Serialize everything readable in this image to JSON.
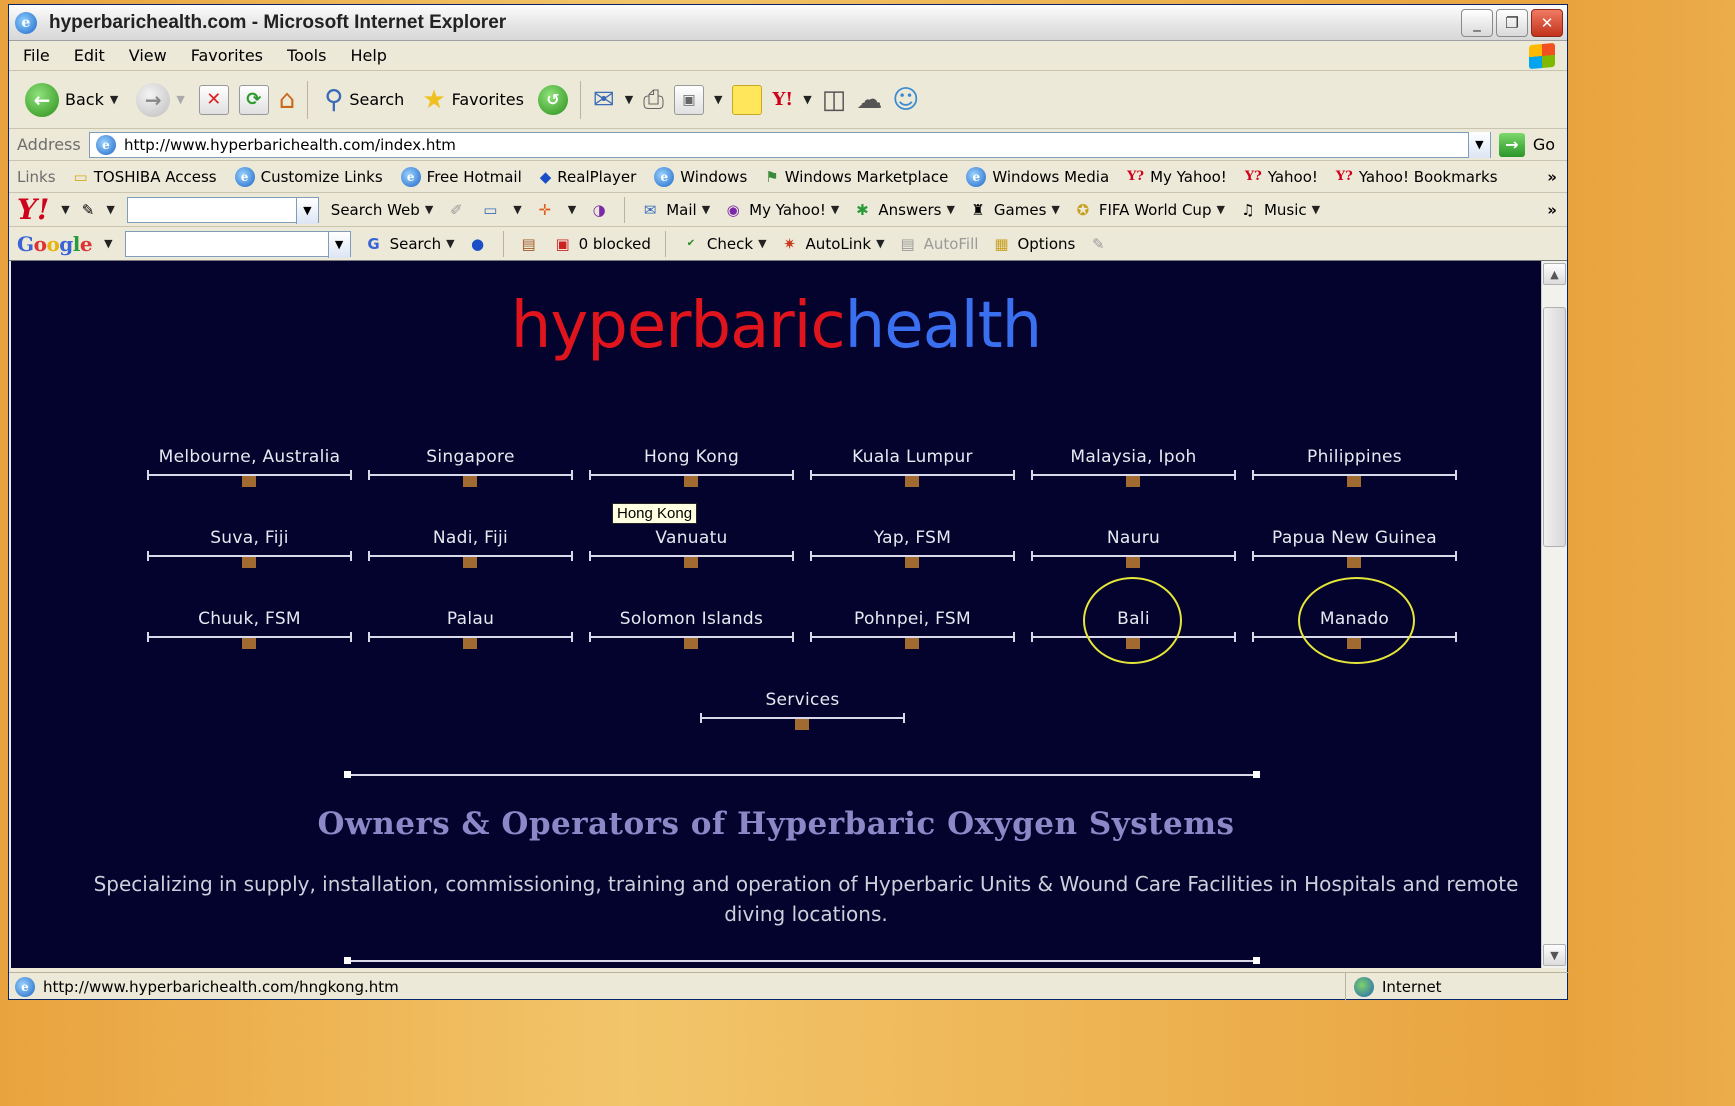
{
  "window": {
    "title": "hyperbarichealth.com - Microsoft Internet Explorer",
    "controls": [
      "_",
      "❐",
      "✕"
    ]
  },
  "menu": [
    "File",
    "Edit",
    "View",
    "Favorites",
    "Tools",
    "Help"
  ],
  "toolbar": {
    "back_label": "Back",
    "search_label": "Search",
    "favorites_label": "Favorites"
  },
  "address": {
    "label": "Address",
    "url": "http://www.hyperbarichealth.com/index.htm",
    "go_label": "Go"
  },
  "links": {
    "label": "Links",
    "items": [
      "TOSHIBA Access",
      "Customize Links",
      "Free Hotmail",
      "RealPlayer",
      "Windows",
      "Windows Marketplace",
      "Windows Media",
      "My Yahoo!",
      "Yahoo!",
      "Yahoo! Bookmarks"
    ],
    "more": "»"
  },
  "yahoo_toolbar": {
    "logo": "Y!",
    "search_label": "Search Web",
    "items": [
      "Mail",
      "My Yahoo!",
      "Answers",
      "Games",
      "FIFA World Cup",
      "Music"
    ],
    "more": "»"
  },
  "google_toolbar": {
    "search_label": "Search",
    "blocked_label": "0 blocked",
    "check_label": "Check",
    "autolink_label": "AutoLink",
    "autofill_label": "AutoFill",
    "options_label": "Options"
  },
  "page": {
    "logo_red": "hyperbaric",
    "logo_blue": "health",
    "locations": [
      [
        "Melbourne, Australia",
        "Singapore",
        "Hong Kong",
        "Kuala Lumpur",
        "Malaysia, Ipoh",
        "Philippines"
      ],
      [
        "Suva, Fiji",
        "Nadi, Fiji",
        "Vanuatu",
        "Yap, FSM",
        "Nauru",
        "Papua New Guinea"
      ],
      [
        "Chuuk, FSM",
        "Palau",
        "Solomon Islands",
        "Pohnpei, FSM",
        "Bali",
        "Manado"
      ]
    ],
    "services_label": "Services",
    "tooltip": "Hong Kong",
    "tagline": "Owners & Operators of Hyperbaric Oxygen Systems",
    "description": "Specializing in supply, installation, commissioning, training  and operation of Hyperbaric Units & Wound Care Facilities in Hospitals and remote diving locations."
  },
  "status": {
    "url": "http://www.hyperbarichealth.com/hngkong.htm",
    "zone": "Internet"
  }
}
